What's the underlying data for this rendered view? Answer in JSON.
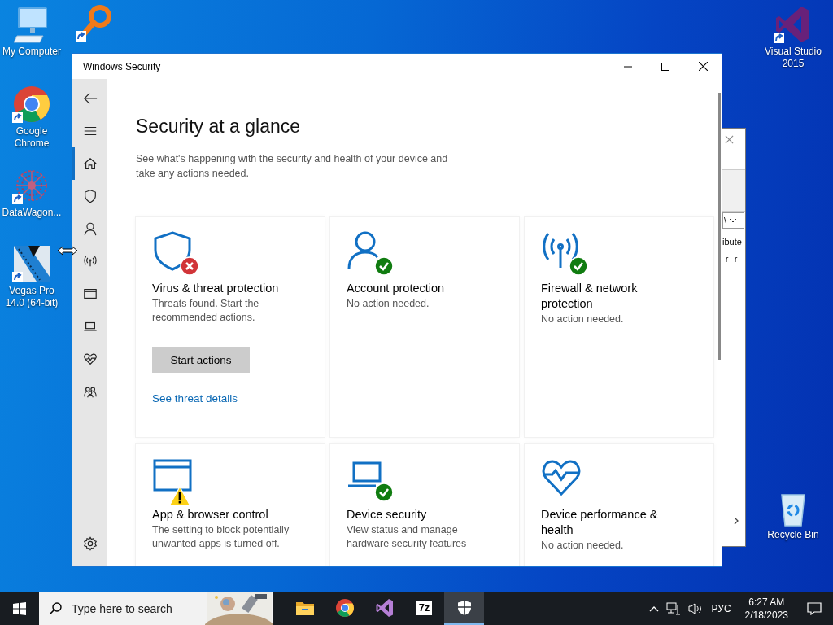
{
  "desktop": {
    "icons": [
      {
        "kind": "computer",
        "label": "My Computer",
        "shortcut": false
      },
      {
        "kind": "magnifier",
        "shortcut": true
      },
      {
        "kind": "chrome",
        "label": "Google Chrome",
        "shortcut": true
      },
      {
        "kind": "datawagon",
        "label": "DataWagon...",
        "shortcut": true
      },
      {
        "kind": "vegas",
        "label": "Vegas Pro 14.0 (64-bit)",
        "shortcut": true
      },
      {
        "kind": "visualstudio",
        "label": "Visual Studio 2015",
        "shortcut": true
      },
      {
        "kind": "recyclebin",
        "label": "Recycle Bin",
        "shortcut": false
      }
    ]
  },
  "background_window": {
    "path_end": "\\",
    "column_head": "ibute",
    "cell": "-r--r-"
  },
  "window": {
    "title": "Windows Security"
  },
  "nav": {
    "items": [
      {
        "kind": "back"
      },
      {
        "kind": "menu"
      },
      {
        "kind": "home",
        "selected": true
      },
      {
        "kind": "shield",
        "selected": false
      },
      {
        "kind": "person",
        "selected": false
      },
      {
        "kind": "antenna",
        "selected": false
      },
      {
        "kind": "browser",
        "selected": false
      },
      {
        "kind": "laptop",
        "selected": false
      },
      {
        "kind": "heart",
        "selected": false
      },
      {
        "kind": "family",
        "selected": false
      },
      {
        "kind": "settings",
        "selected": false
      }
    ]
  },
  "page": {
    "heading": "Security at a glance",
    "subtitle": "See what's happening with the security and health of your device and take any actions needed."
  },
  "cards": [
    {
      "kind": "shield",
      "badge": {
        "kind": "error"
      },
      "title": "Virus & threat protection",
      "description": "Threats found. Start the recommended actions.",
      "button": "Start actions",
      "link": "See threat details"
    },
    {
      "kind": "person",
      "badge": {
        "kind": "ok"
      },
      "title": "Account protection",
      "description": "No action needed."
    },
    {
      "kind": "antenna",
      "badge": {
        "kind": "ok"
      },
      "title": "Firewall & network protection",
      "description": "No action needed."
    },
    {
      "kind": "browser",
      "badge": {
        "kind": "warning"
      },
      "title": "App & browser control",
      "description": "The setting to block potentially unwanted apps is turned off."
    },
    {
      "kind": "laptop",
      "badge": {
        "kind": "ok"
      },
      "title": "Device security",
      "description": "View status and manage hardware security features"
    },
    {
      "kind": "heart",
      "title": "Device performance & health",
      "description": "No action needed."
    }
  ],
  "taskbar": {
    "search_placeholder": "Type here to search",
    "apps": [
      {
        "kind": "folder",
        "selected": false
      },
      {
        "kind": "chrome",
        "selected": false
      },
      {
        "kind": "visualstudio",
        "selected": false
      },
      {
        "kind": "archiver",
        "label": "7z",
        "selected": false
      },
      {
        "kind": "security",
        "selected": true
      }
    ],
    "language": "РУС",
    "time": "6:27 AM",
    "date": "2/18/2023"
  }
}
